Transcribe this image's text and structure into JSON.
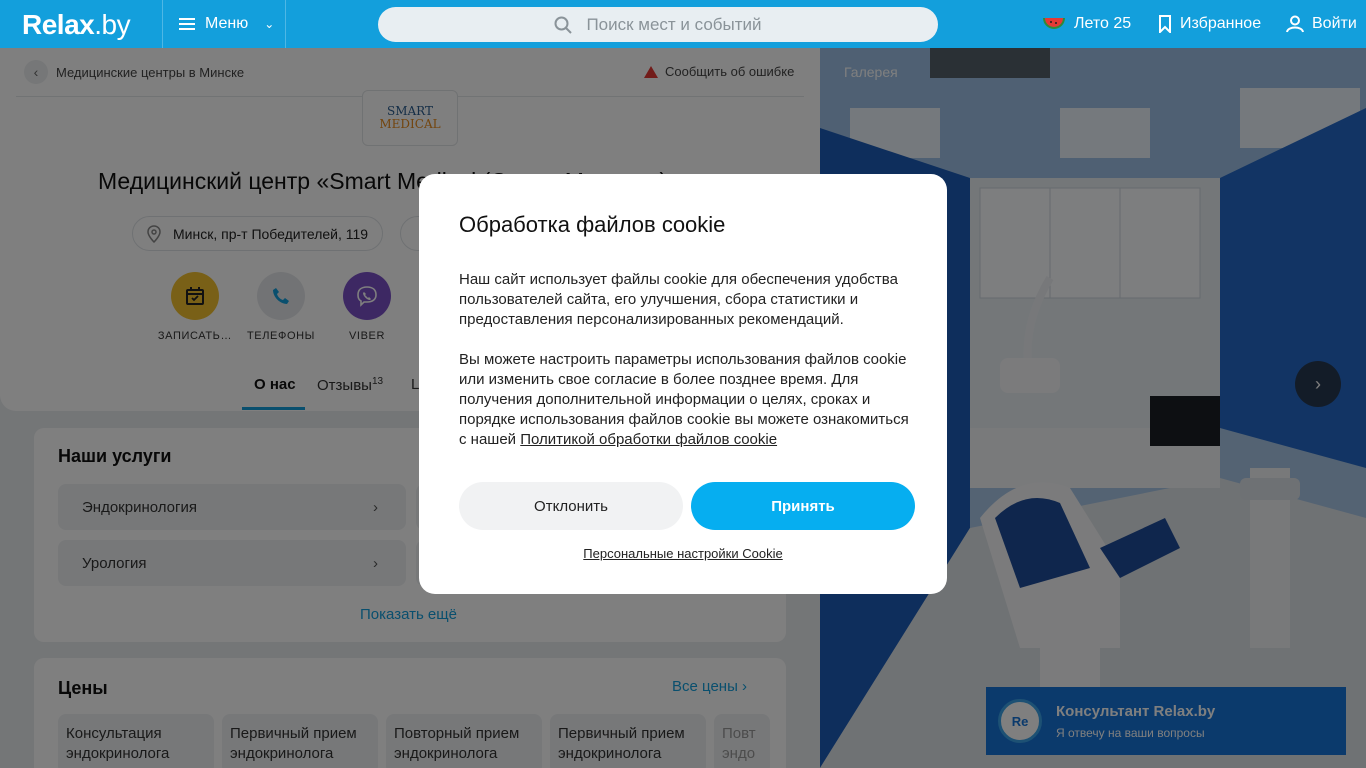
{
  "header": {
    "logo_main": "Relax",
    "logo_suffix": ".by",
    "menu_label": "Меню",
    "search_placeholder": "Поиск мест и событий",
    "summer_label": "Лето 25",
    "favorites_label": "Избранное",
    "login_label": "Войти"
  },
  "page": {
    "breadcrumb": "Медицинские центры в Минске",
    "report_error": "Сообщить об ошибке",
    "logo_line1": "SMART",
    "logo_line2": "MEDICAL",
    "title": "Медицинский центр «Smart Medical (Смарт Медикал)»",
    "address": "Минск, пр-т Победителей, 119",
    "actions": [
      {
        "label": "ЗАПИСАТЬ…",
        "color": "#f2c12e"
      },
      {
        "label": "ТЕЛЕФОНЫ",
        "color": "#e4e7ea"
      },
      {
        "label": "VIBER",
        "color": "#7b51c7"
      }
    ],
    "tabs": [
      {
        "label": "О нас"
      },
      {
        "label": "Отзывы",
        "count": "13"
      },
      {
        "label": "L"
      }
    ],
    "services_title": "Наши услуги",
    "services": [
      "Эндокринология",
      "Урология"
    ],
    "show_more": "Показать ещё",
    "prices_title": "Цены",
    "all_prices": "Все цены",
    "prices": [
      "Консультация эндокринолога",
      "Первичный прием эндокринолога",
      "Повторный прием эндокринолога",
      "Первичный прием эндокринолога",
      "Повт эндо"
    ]
  },
  "gallery": {
    "title": "Галерея"
  },
  "consultant": {
    "avatar": "Re",
    "title": "Консультант Relax.by",
    "subtitle": "Я отвечу на ваши вопросы"
  },
  "cookie_modal": {
    "title": "Обработка файлов cookie",
    "para1": "Наш сайт использует файлы cookie для обеспечения удобства пользователей сайта, его улучшения, сбора статистики и предоставления персонализированных рекомендаций.",
    "para2": "Вы можете настроить параметры использования файлов cookie или изменить свое согласие в более позднее время. Для получения дополнительной информации о целях, сроках и порядке использования файлов cookie вы можете ознакомиться с нашей",
    "policy_link": "Политикой обработки файлов cookie",
    "decline": "Отклонить",
    "accept": "Принять",
    "settings": "Персональные настройки Cookie"
  },
  "colors": {
    "brand": "#139fdc",
    "accept": "#06aef0",
    "consultant": "#1775d9"
  }
}
